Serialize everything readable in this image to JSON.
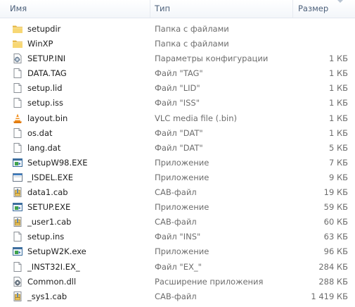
{
  "columns": {
    "name": "Имя",
    "type": "Тип",
    "size": "Размер"
  },
  "files": [
    {
      "name": "setupdir",
      "type": "Папка с файлами",
      "size": "",
      "icon": "folder-icon"
    },
    {
      "name": "WinXP",
      "type": "Папка с файлами",
      "size": "",
      "icon": "folder-icon"
    },
    {
      "name": "SETUP.INI",
      "type": "Параметры конфигурации",
      "size": "1 КБ",
      "icon": "config-file-icon"
    },
    {
      "name": "DATA.TAG",
      "type": "Файл \"TAG\"",
      "size": "1 КБ",
      "icon": "generic-file-icon"
    },
    {
      "name": "setup.lid",
      "type": "Файл \"LID\"",
      "size": "1 КБ",
      "icon": "generic-file-icon"
    },
    {
      "name": "setup.iss",
      "type": "Файл \"ISS\"",
      "size": "1 КБ",
      "icon": "generic-file-icon"
    },
    {
      "name": "layout.bin",
      "type": "VLC media file (.bin)",
      "size": "1 КБ",
      "icon": "vlc-cone-icon"
    },
    {
      "name": "os.dat",
      "type": "Файл \"DAT\"",
      "size": "1 КБ",
      "icon": "generic-file-icon"
    },
    {
      "name": "lang.dat",
      "type": "Файл \"DAT\"",
      "size": "5 КБ",
      "icon": "generic-file-icon"
    },
    {
      "name": "SetupW98.EXE",
      "type": "Приложение",
      "size": "7 КБ",
      "icon": "setup-exe-icon"
    },
    {
      "name": "_ISDEL.EXE",
      "type": "Приложение",
      "size": "9 КБ",
      "icon": "application-icon"
    },
    {
      "name": "data1.cab",
      "type": "CAB-файл",
      "size": "19 КБ",
      "icon": "cab-archive-icon"
    },
    {
      "name": "SETUP.EXE",
      "type": "Приложение",
      "size": "59 КБ",
      "icon": "setup-exe-icon"
    },
    {
      "name": "_user1.cab",
      "type": "CAB-файл",
      "size": "60 КБ",
      "icon": "cab-archive-icon"
    },
    {
      "name": "setup.ins",
      "type": "Файл \"INS\"",
      "size": "63 КБ",
      "icon": "generic-file-icon"
    },
    {
      "name": "SetupW2K.exe",
      "type": "Приложение",
      "size": "96 КБ",
      "icon": "setup-exe-icon"
    },
    {
      "name": "_INST32I.EX_",
      "type": "Файл \"EX_\"",
      "size": "284 КБ",
      "icon": "generic-file-icon"
    },
    {
      "name": "Common.dll",
      "type": "Расширение приложения",
      "size": "288 КБ",
      "icon": "dll-gear-icon"
    },
    {
      "name": "_sys1.cab",
      "type": "CAB-файл",
      "size": "1 419 КБ",
      "icon": "cab-archive-icon"
    }
  ]
}
